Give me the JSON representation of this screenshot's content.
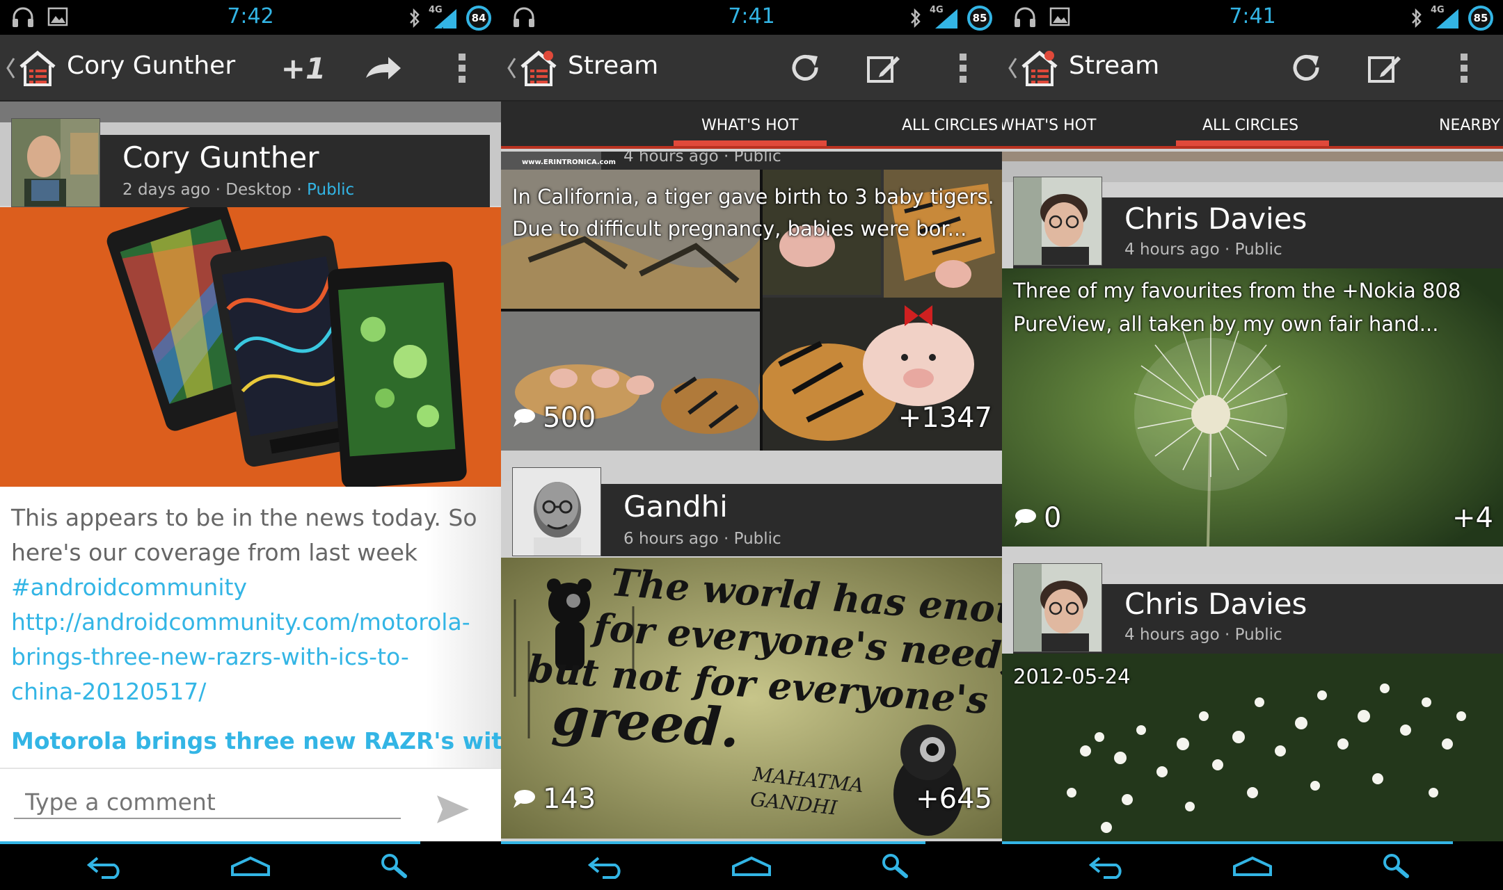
{
  "colors": {
    "holo_blue": "#33b5e5",
    "gplus_red": "#e0493a",
    "action_bar": "#333333"
  },
  "screens": [
    {
      "status": {
        "time": "7:42",
        "battery": "84",
        "network": "4G"
      },
      "action_bar": {
        "title": "Cory Gunther",
        "plus_one": "+1"
      },
      "post": {
        "author": "Cory Gunther",
        "time": "2 days ago",
        "source": "Desktop",
        "visibility": "Public",
        "body_lines": [
          "This appears to be in the news today. So",
          "here's our coverage from last week"
        ],
        "hashtag": "#androidcommunity",
        "link_lines": [
          "http://androidcommunity.com/motorola-",
          "brings-three-new-razrs-with-ics-to-",
          "china-20120517/"
        ],
        "link_title": "Motorola brings three new RAZR's with"
      },
      "comment": {
        "placeholder": "Type a comment"
      }
    },
    {
      "status": {
        "time": "7:41",
        "battery": "85",
        "network": "4G"
      },
      "action_bar": {
        "title": "Stream"
      },
      "tabs": [
        "WHAT'S HOT",
        "ALL CIRCLES"
      ],
      "top_meta": "4 hours ago · Public",
      "watermark": "www.ERINTRONICA.com",
      "tiger_post": {
        "text_lines": [
          "In California, a tiger gave birth to 3 baby tigers.",
          "Due to difficult pregnancy, babies were bor..."
        ],
        "comments": "500",
        "plus": "+1347"
      },
      "gandhi_post": {
        "author": "Gandhi",
        "meta": "6 hours ago · Public",
        "quote_lines": [
          "The world has enough",
          "for everyone's need,",
          "but not for everyone's",
          "greed."
        ],
        "signature": "MAHATMA GANDHI",
        "comments": "143",
        "plus": "+645"
      }
    },
    {
      "status": {
        "time": "7:41",
        "battery": "85",
        "network": "4G"
      },
      "action_bar": {
        "title": "Stream"
      },
      "tabs": [
        "WHAT'S HOT",
        "ALL CIRCLES",
        "NEARBY"
      ],
      "post1": {
        "author": "Chris Davies",
        "meta": "4 hours ago · Public",
        "text_lines": [
          "Three of my favourites from the +Nokia 808",
          "PureView, all taken by my own fair hand..."
        ],
        "comments": "0",
        "plus": "+4"
      },
      "post2": {
        "author": "Chris Davies",
        "meta": "4 hours ago · Public",
        "date": "2012-05-24"
      }
    }
  ]
}
